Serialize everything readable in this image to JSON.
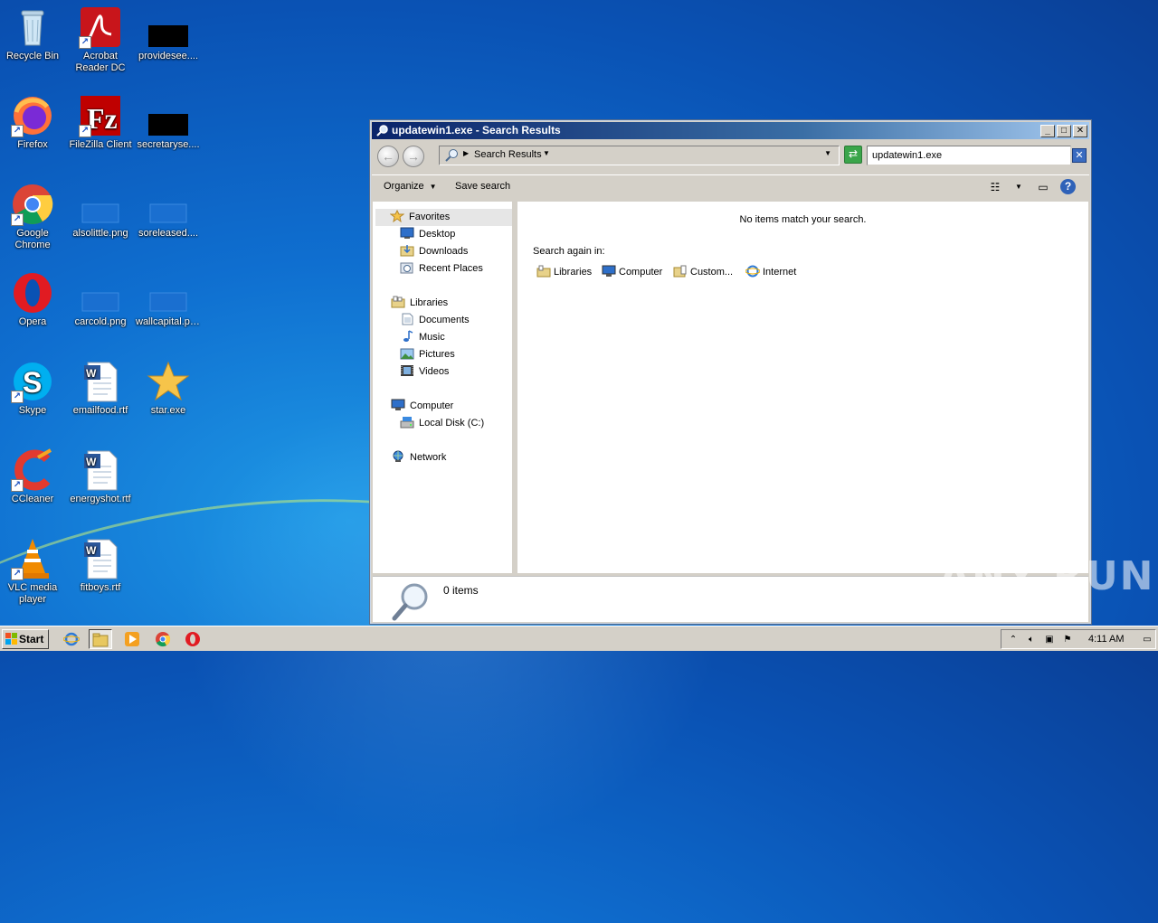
{
  "desktop": {
    "icons": [
      {
        "label": "Recycle Bin"
      },
      {
        "label": "Acrobat Reader DC"
      },
      {
        "label": "providesee...."
      },
      {
        "label": "Firefox"
      },
      {
        "label": "FileZilla Client"
      },
      {
        "label": "secretaryse...."
      },
      {
        "label": "Google Chrome"
      },
      {
        "label": "alsolittle.png"
      },
      {
        "label": "soreleased...."
      },
      {
        "label": "Opera"
      },
      {
        "label": "carcold.png"
      },
      {
        "label": "wallcapital.png"
      },
      {
        "label": "Skype"
      },
      {
        "label": "emailfood.rtf"
      },
      {
        "label": "star.exe"
      },
      {
        "label": "CCleaner"
      },
      {
        "label": "energyshot.rtf"
      },
      {
        "label": "VLC media player"
      },
      {
        "label": "fitboys.rtf"
      }
    ]
  },
  "window": {
    "title": "updatewin1.exe - Search Results",
    "address": {
      "crumb": "Search Results"
    },
    "search": {
      "value": "updatewin1.exe"
    },
    "toolbar": {
      "organize": "Organize",
      "save_search": "Save search"
    },
    "nav": {
      "favorites": "Favorites",
      "desktop": "Desktop",
      "downloads": "Downloads",
      "recent_places": "Recent Places",
      "libraries": "Libraries",
      "documents": "Documents",
      "music": "Music",
      "pictures": "Pictures",
      "videos": "Videos",
      "computer": "Computer",
      "local_disk": "Local Disk (C:)",
      "network": "Network"
    },
    "content": {
      "no_items": "No items match your search.",
      "search_again": "Search again in:",
      "locations": {
        "libraries": "Libraries",
        "computer": "Computer",
        "custom": "Custom...",
        "internet": "Internet"
      }
    },
    "details": {
      "count": "0 items"
    }
  },
  "taskbar": {
    "start": "Start",
    "clock": "4:11 AM"
  },
  "watermark": "ANY RUN"
}
